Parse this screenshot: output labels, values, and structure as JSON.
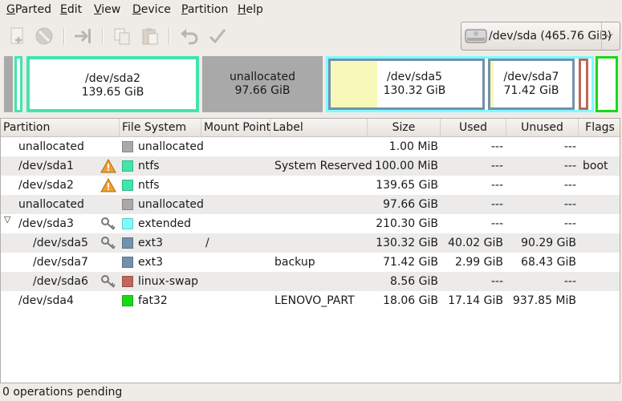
{
  "menubar": {
    "items": [
      {
        "pre": "",
        "u": "G",
        "post": "Parted"
      },
      {
        "pre": "",
        "u": "E",
        "post": "dit"
      },
      {
        "pre": "",
        "u": "V",
        "post": "iew"
      },
      {
        "pre": "",
        "u": "D",
        "post": "evice"
      },
      {
        "pre": "",
        "u": "P",
        "post": "artition"
      },
      {
        "pre": "",
        "u": "H",
        "post": "elp"
      }
    ]
  },
  "toolbar": {
    "icons": [
      "new-partition-icon",
      "delete-icon",
      "resize-move-icon",
      "copy-icon",
      "paste-icon",
      "undo-icon",
      "apply-icon"
    ]
  },
  "device_selector": {
    "label": "/dev/sda  (465.76 GiB)"
  },
  "map": {
    "sda2": {
      "name": "/dev/sda2",
      "size": "139.65 GiB"
    },
    "unalloc": {
      "name": "unallocated",
      "size": "97.66 GiB"
    },
    "sda5": {
      "name": "/dev/sda5",
      "size": "130.32 GiB"
    },
    "sda7": {
      "name": "/dev/sda7",
      "size": "71.42 GiB"
    }
  },
  "colors": {
    "ntfs": "#42e5ac",
    "unallocated": "#a9a9a9",
    "extended": "#7dfcfe",
    "ext3": "#7590ae",
    "linux-swap": "#c1665a",
    "fat32": "#18d918",
    "used_fill": "#f8f8b8"
  },
  "table": {
    "headers": {
      "partition": "Partition",
      "filesystem": "File System",
      "mountpoint": "Mount Point",
      "label": "Label",
      "size": "Size",
      "used": "Used",
      "unused": "Unused",
      "flags": "Flags"
    },
    "rows": [
      {
        "partition": "unallocated",
        "indent": 0,
        "icon": "",
        "fs": "unallocated",
        "fscolor": "#a9a9a9",
        "mount": "",
        "label": "",
        "size": "1.00 MiB",
        "used": "---",
        "unused": "---",
        "flags": ""
      },
      {
        "partition": "/dev/sda1",
        "indent": 0,
        "icon": "warning-icon",
        "fs": "ntfs",
        "fscolor": "#42e5ac",
        "mount": "",
        "label": "System Reserved",
        "size": "100.00 MiB",
        "used": "---",
        "unused": "---",
        "flags": "boot"
      },
      {
        "partition": "/dev/sda2",
        "indent": 0,
        "icon": "warning-icon",
        "fs": "ntfs",
        "fscolor": "#42e5ac",
        "mount": "",
        "label": "",
        "size": "139.65 GiB",
        "used": "---",
        "unused": "---",
        "flags": ""
      },
      {
        "partition": "unallocated",
        "indent": 0,
        "icon": "",
        "fs": "unallocated",
        "fscolor": "#a9a9a9",
        "mount": "",
        "label": "",
        "size": "97.66 GiB",
        "used": "---",
        "unused": "---",
        "flags": ""
      },
      {
        "partition": "/dev/sda3",
        "indent": 0,
        "expander": true,
        "icon": "key-icon",
        "fs": "extended",
        "fscolor": "#7dfcfe",
        "mount": "",
        "label": "",
        "size": "210.30 GiB",
        "used": "---",
        "unused": "---",
        "flags": ""
      },
      {
        "partition": "/dev/sda5",
        "indent": 1,
        "icon": "key-icon",
        "fs": "ext3",
        "fscolor": "#7590ae",
        "mount": "/",
        "label": "",
        "size": "130.32 GiB",
        "used": "40.02 GiB",
        "unused": "90.29 GiB",
        "flags": ""
      },
      {
        "partition": "/dev/sda7",
        "indent": 1,
        "icon": "",
        "fs": "ext3",
        "fscolor": "#7590ae",
        "mount": "",
        "label": "backup",
        "size": "71.42 GiB",
        "used": "2.99 GiB",
        "unused": "68.43 GiB",
        "flags": ""
      },
      {
        "partition": "/dev/sda6",
        "indent": 1,
        "icon": "key-icon",
        "fs": "linux-swap",
        "fscolor": "#c1665a",
        "mount": "",
        "label": "",
        "size": "8.56 GiB",
        "used": "---",
        "unused": "---",
        "flags": ""
      },
      {
        "partition": "/dev/sda4",
        "indent": 0,
        "icon": "",
        "fs": "fat32",
        "fscolor": "#18d918",
        "mount": "",
        "label": "LENOVO_PART",
        "size": "18.06 GiB",
        "used": "17.14 GiB",
        "unused": "937.85 MiB",
        "flags": ""
      }
    ]
  },
  "status": {
    "text": "0 operations pending"
  }
}
